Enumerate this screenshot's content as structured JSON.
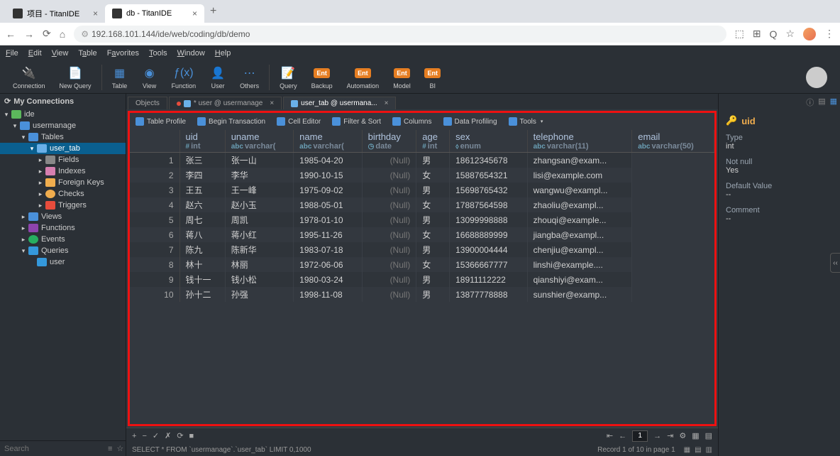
{
  "browser": {
    "tabs": [
      {
        "title": "项目 - TitanIDE",
        "active": false
      },
      {
        "title": "db - TitanIDE",
        "active": true
      }
    ],
    "url": "192.168.101.144/ide/web/coding/db/demo"
  },
  "menus": [
    "File",
    "Edit",
    "View",
    "Table",
    "Favorites",
    "Tools",
    "Window",
    "Help"
  ],
  "toolbar": [
    {
      "label": "Connection"
    },
    {
      "label": "New Query"
    },
    {
      "label": "Table"
    },
    {
      "label": "View"
    },
    {
      "label": "Function"
    },
    {
      "label": "User"
    },
    {
      "label": "Others"
    },
    {
      "label": "Query"
    },
    {
      "label": "Backup",
      "ent": true
    },
    {
      "label": "Automation",
      "ent": true
    },
    {
      "label": "Model",
      "ent": true
    },
    {
      "label": "BI",
      "ent": true
    }
  ],
  "sidebar": {
    "title": "My Connections",
    "search": "Search",
    "tree": [
      {
        "label": "ide",
        "depth": 0,
        "icon": "i-green",
        "toggle": "▾"
      },
      {
        "label": "usermanage",
        "depth": 1,
        "icon": "i-db",
        "toggle": "▾"
      },
      {
        "label": "Tables",
        "depth": 2,
        "icon": "i-folder",
        "toggle": "▾"
      },
      {
        "label": "user_tab",
        "depth": 3,
        "icon": "i-table",
        "toggle": "▾",
        "selected": true
      },
      {
        "label": "Fields",
        "depth": 4,
        "icon": "i-fields",
        "toggle": "▸"
      },
      {
        "label": "Indexes",
        "depth": 4,
        "icon": "i-az",
        "toggle": "▸"
      },
      {
        "label": "Foreign Keys",
        "depth": 4,
        "icon": "i-key",
        "toggle": "▸"
      },
      {
        "label": "Checks",
        "depth": 4,
        "icon": "i-check",
        "toggle": "▸"
      },
      {
        "label": "Triggers",
        "depth": 4,
        "icon": "i-trigger",
        "toggle": "▸"
      },
      {
        "label": "Views",
        "depth": 2,
        "icon": "i-folder",
        "toggle": "▸"
      },
      {
        "label": "Functions",
        "depth": 2,
        "icon": "i-func",
        "toggle": "▸"
      },
      {
        "label": "Events",
        "depth": 2,
        "icon": "i-event",
        "toggle": "▸"
      },
      {
        "label": "Queries",
        "depth": 2,
        "icon": "i-query",
        "toggle": "▾"
      },
      {
        "label": "user",
        "depth": 3,
        "icon": "i-query",
        "toggle": ""
      }
    ]
  },
  "editorTabs": [
    {
      "label": "Objects",
      "active": false
    },
    {
      "label": "* user @ usermanage",
      "active": false,
      "dirty": true
    },
    {
      "label": "user_tab @ usermana...",
      "active": true
    }
  ],
  "tableTools": [
    "Table Profile",
    "Begin Transaction",
    "Cell Editor",
    "Filter & Sort",
    "Columns",
    "Data Profiling",
    "Tools"
  ],
  "columns": [
    {
      "name": "uid",
      "type": "int",
      "icon": "#"
    },
    {
      "name": "uname",
      "type": "varchar(",
      "icon": "abc"
    },
    {
      "name": "name",
      "type": "varchar(",
      "icon": "abc"
    },
    {
      "name": "birthday",
      "type": "date",
      "icon": "◷"
    },
    {
      "name": "age",
      "type": "int",
      "icon": "#"
    },
    {
      "name": "sex",
      "type": "enum",
      "icon": "⬨"
    },
    {
      "name": "telephone",
      "type": "varchar(11)",
      "icon": "abc"
    },
    {
      "name": "email",
      "type": "varchar(50)",
      "icon": "abc"
    }
  ],
  "rows": [
    {
      "n": 1,
      "uname": "张三",
      "name": "张一山",
      "birthday": "1985-04-20",
      "age": "(Null)",
      "sex": "男",
      "telephone": "18612345678",
      "email": "zhangsan@exam..."
    },
    {
      "n": 2,
      "uname": "李四",
      "name": "李华",
      "birthday": "1990-10-15",
      "age": "(Null)",
      "sex": "女",
      "telephone": "15887654321",
      "email": "lisi@example.com"
    },
    {
      "n": 3,
      "uname": "王五",
      "name": "王一峰",
      "birthday": "1975-09-02",
      "age": "(Null)",
      "sex": "男",
      "telephone": "15698765432",
      "email": "wangwu@exampl..."
    },
    {
      "n": 4,
      "uname": "赵六",
      "name": "赵小玉",
      "birthday": "1988-05-01",
      "age": "(Null)",
      "sex": "女",
      "telephone": "17887564598",
      "email": "zhaoliu@exampl..."
    },
    {
      "n": 5,
      "uname": "周七",
      "name": "周凯",
      "birthday": "1978-01-10",
      "age": "(Null)",
      "sex": "男",
      "telephone": "13099998888",
      "email": "zhouqi@example..."
    },
    {
      "n": 6,
      "uname": "蒋八",
      "name": "蒋小红",
      "birthday": "1995-11-26",
      "age": "(Null)",
      "sex": "女",
      "telephone": "16688889999",
      "email": "jiangba@exampl..."
    },
    {
      "n": 7,
      "uname": "陈九",
      "name": "陈新华",
      "birthday": "1983-07-18",
      "age": "(Null)",
      "sex": "男",
      "telephone": "13900004444",
      "email": "chenjiu@exampl..."
    },
    {
      "n": 8,
      "uname": "林十",
      "name": "林丽",
      "birthday": "1972-06-06",
      "age": "(Null)",
      "sex": "女",
      "telephone": "15366667777",
      "email": "linshi@example...."
    },
    {
      "n": 9,
      "uname": "钱十一",
      "name": "钱小松",
      "birthday": "1980-03-24",
      "age": "(Null)",
      "sex": "男",
      "telephone": "18911112222",
      "email": "qianshiyi@exam..."
    },
    {
      "n": 10,
      "uname": "孙十二",
      "name": "孙强",
      "birthday": "1998-11-08",
      "age": "(Null)",
      "sex": "男",
      "telephone": "13877778888",
      "email": "sunshier@examp..."
    }
  ],
  "pager": {
    "page": "1"
  },
  "sql": "SELECT * FROM `usermanage`.`user_tab` LIMIT 0,1000",
  "recordStatus": "Record 1 of 10 in page 1",
  "rightPanel": {
    "title": "uid",
    "props": [
      {
        "label": "Type",
        "value": "int"
      },
      {
        "label": "Not null",
        "value": "Yes"
      },
      {
        "label": "Default Value",
        "value": "--"
      },
      {
        "label": "Comment",
        "value": "--"
      }
    ]
  }
}
